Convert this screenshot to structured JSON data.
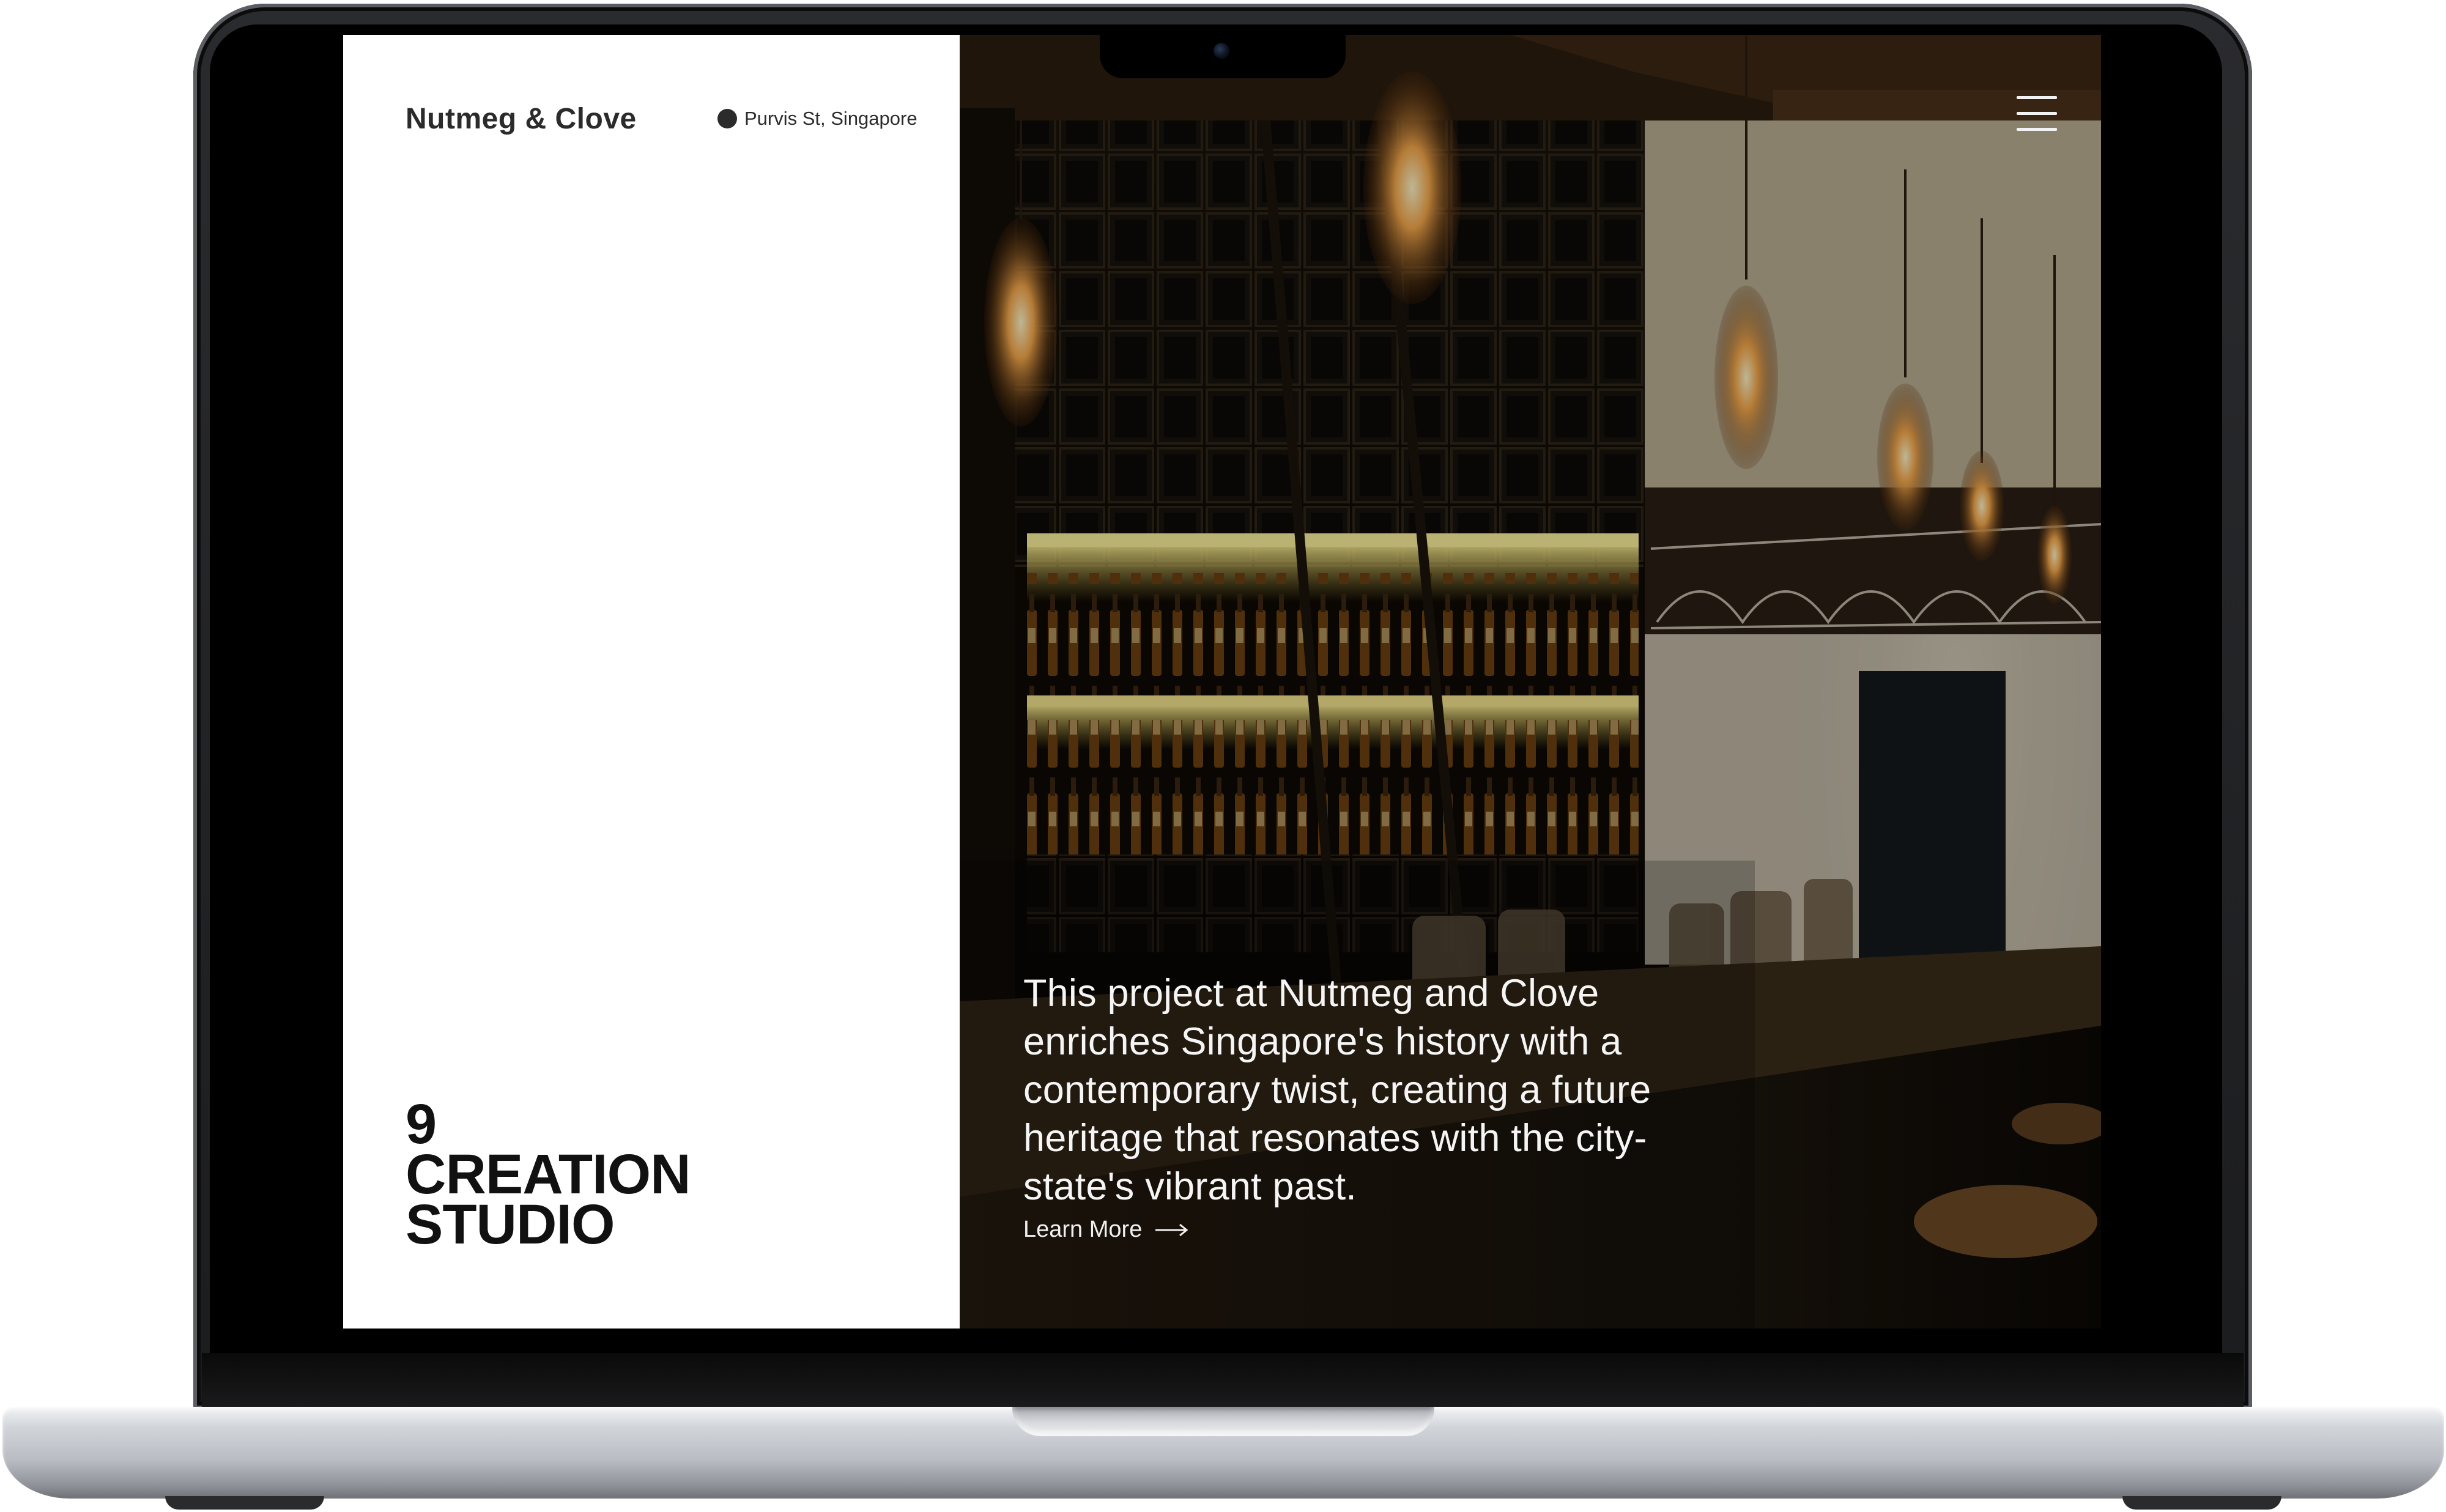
{
  "site": {
    "brand": "Nutmeg & Clove",
    "location": "Purvis St, Singapore",
    "studio_lines": [
      "9",
      "CREATION",
      "STUDIO"
    ]
  },
  "hero": {
    "caption": "This project at Nutmeg and Clove enriches Singapore's history with a contemporary twist, creating a future heritage that resonates with the city-state's vibrant past.",
    "cta_label": "Learn More"
  },
  "icons": {
    "menu": "hamburger-menu-icon",
    "location": "location-dot-icon",
    "cta": "arrow-right-icon"
  },
  "colors": {
    "text_dark": "#2b2b2b",
    "caption_text": "#f5f5f5",
    "pendant_glow": "#f2a64a",
    "shelf_light": "#e8d96a"
  }
}
